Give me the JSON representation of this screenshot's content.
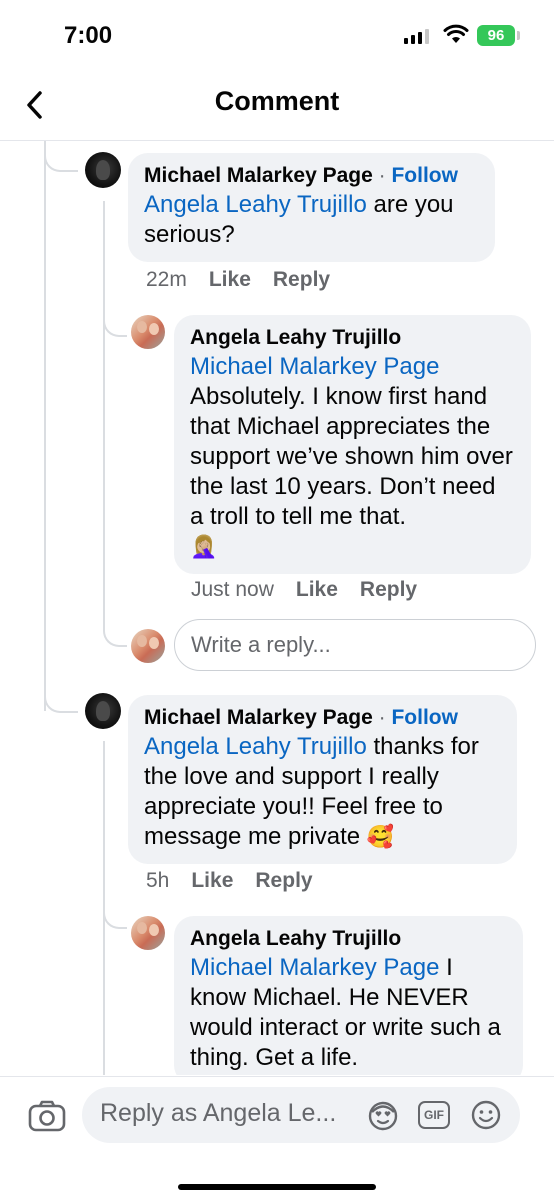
{
  "status": {
    "time": "7:00",
    "battery": "96"
  },
  "header": {
    "title": "Comment"
  },
  "comments": [
    {
      "author": "Michael Malarkey Page",
      "separator": "·",
      "follow": "Follow",
      "mention": "Angela Leahy Trujillo",
      "text": " are you serious?",
      "time": "22m",
      "like": "Like",
      "reply": "Reply"
    },
    {
      "author": "Angela Leahy Trujillo",
      "mention": "Michael Malarkey Page",
      "text": "Absolutely. I know first hand that Michael appreciates the support we’ve shown him over the last 10 years. Don’t need a troll to tell me that.",
      "emoji": "🤦🏼‍♀️",
      "time": "Just now",
      "like": "Like",
      "reply": "Reply"
    },
    {
      "author": "Michael Malarkey Page",
      "separator": "·",
      "follow": "Follow",
      "mention": "Angela Leahy Trujillo",
      "text": " thanks for the love and support I really appreciate you!! Feel free to message me private ",
      "emoji": "🥰",
      "time": "5h",
      "like": "Like",
      "reply": "Reply"
    },
    {
      "author": "Angela Leahy Trujillo",
      "mention": "Michael Malarkey Page",
      "text": " I know Michael. He NEVER would interact or write such a thing. Get a life."
    }
  ],
  "reply_input": {
    "placeholder": "Write a reply..."
  },
  "composer": {
    "placeholder": "Reply as Angela Le...",
    "gif_label": "GIF"
  },
  "colors": {
    "link": "#0a66c2",
    "bubble": "#f0f2f5",
    "muted": "#65676b",
    "battery": "#34c759"
  },
  "icons": [
    "back-chevron-icon",
    "camera-icon",
    "avatar-sticker-icon",
    "gif-icon",
    "emoji-icon",
    "wifi-icon",
    "signal-icon",
    "battery-icon"
  ]
}
